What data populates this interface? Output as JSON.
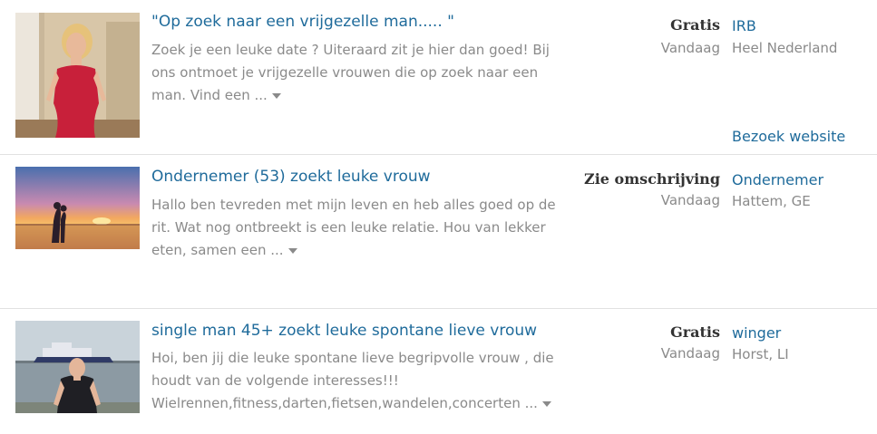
{
  "listings": [
    {
      "image_alt": "woman-in-red-dress-photo",
      "title": "\"Op zoek naar een vrijgezelle man..... \"",
      "desc_lines": [
        "Zoek je een leuke date ? Uiteraard zit je hier dan goed! Bij",
        "ons ontmoet je vrijgezelle vrouwen die op zoek naar een",
        "man. Vind een ..."
      ],
      "price": "Gratis",
      "date": "Vandaag",
      "user": "IRB",
      "location": "Heel Nederland",
      "visit_link": "Bezoek website"
    },
    {
      "image_alt": "couple-at-sunset-photo",
      "title": "Ondernemer (53) zoekt leuke vrouw",
      "desc_lines": [
        "Hallo ben tevreden met mijn leven en heb alles goed op de",
        "rit. Wat nog ontbreekt is een leuke relatie. Hou van lekker",
        "eten, samen een ..."
      ],
      "price": "Zie omschrijving",
      "date": "Vandaag",
      "user": "Ondernemer",
      "location": "Hattem, GE"
    },
    {
      "image_alt": "man-by-harbor-photo",
      "title": "single man 45+ zoekt leuke spontane lieve vrouw",
      "desc_lines": [
        "Hoi, ben jij die leuke spontane lieve begripvolle vrouw , die",
        "houdt van de volgende interesses!!!",
        "Wielrennen,fitness,darten,fietsen,wandelen,concerten ..."
      ],
      "price": "Gratis",
      "date": "Vandaag",
      "user": "winger",
      "location": "Horst, LI"
    }
  ]
}
